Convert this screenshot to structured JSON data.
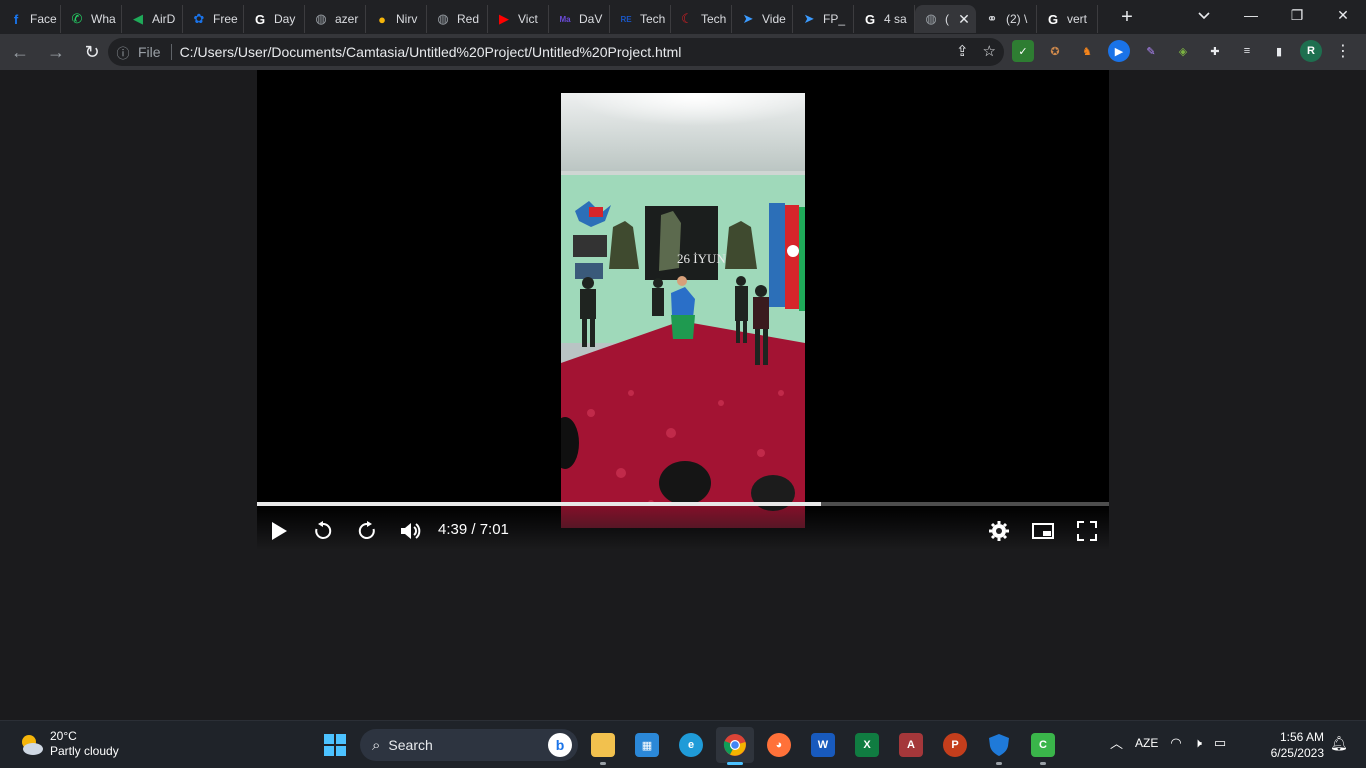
{
  "tabs": [
    {
      "title": "Face",
      "icon": "facebook-icon",
      "color": "#1877f2",
      "glyph": "f"
    },
    {
      "title": "Wha",
      "icon": "whatsapp-icon",
      "color": "#25d366",
      "glyph": "✆"
    },
    {
      "title": "AirD",
      "icon": "airdrop-icon",
      "color": "#1faa59",
      "glyph": "◀"
    },
    {
      "title": "Free",
      "icon": "shield-bee-icon",
      "color": "#1a73e8",
      "glyph": "✿"
    },
    {
      "title": "Day",
      "icon": "google-icon",
      "color": "#ffffff",
      "glyph": "G"
    },
    {
      "title": "azer",
      "icon": "globe-icon",
      "color": "#9aa0a6",
      "glyph": "◍"
    },
    {
      "title": "Nirv",
      "icon": "coin-icon",
      "color": "#f5b50a",
      "glyph": "●"
    },
    {
      "title": "Red",
      "icon": "globe-icon",
      "color": "#9aa0a6",
      "glyph": "◍"
    },
    {
      "title": "Vict",
      "icon": "youtube-icon",
      "color": "#ff0000",
      "glyph": "▶"
    },
    {
      "title": "DaV",
      "icon": "ma-icon",
      "color": "#6a4bd8",
      "glyph": "Ma"
    },
    {
      "title": "Tech",
      "icon": "re-icon",
      "color": "#1a56c4",
      "glyph": "RE"
    },
    {
      "title": "Tech",
      "icon": "crescent-icon",
      "color": "#e31e24",
      "glyph": "☾"
    },
    {
      "title": "Vide",
      "icon": "fish-icon",
      "color": "#3b9bff",
      "glyph": "➤"
    },
    {
      "title": "FP_",
      "icon": "fish-icon",
      "color": "#3b9bff",
      "glyph": "➤"
    },
    {
      "title": "4 sa",
      "icon": "google-icon",
      "color": "#ffffff",
      "glyph": "G"
    },
    {
      "title": "(",
      "icon": "globe-icon",
      "color": "#9aa0a6",
      "glyph": "◍",
      "active": true
    },
    {
      "title": "(2) \\",
      "icon": "binoculars-icon",
      "color": "#dadce0",
      "glyph": "⚭"
    },
    {
      "title": "vert",
      "icon": "google-icon",
      "color": "#ffffff",
      "glyph": "G"
    }
  ],
  "toolbar": {
    "scheme_label": "File",
    "url": "C:/Users/User/Documents/Camtasia/Untitled%20Project/Untitled%20Project.html",
    "profile_initial": "R"
  },
  "player": {
    "time_display": "4:39 / 7:01",
    "progress_fraction": 0.662,
    "banner_text": "26 İYUN"
  },
  "taskbar": {
    "temperature": "20°C",
    "weather": "Partly cloudy",
    "search_label": "Search",
    "language": "AZE",
    "time": "1:56 AM",
    "date": "6/25/2023"
  }
}
